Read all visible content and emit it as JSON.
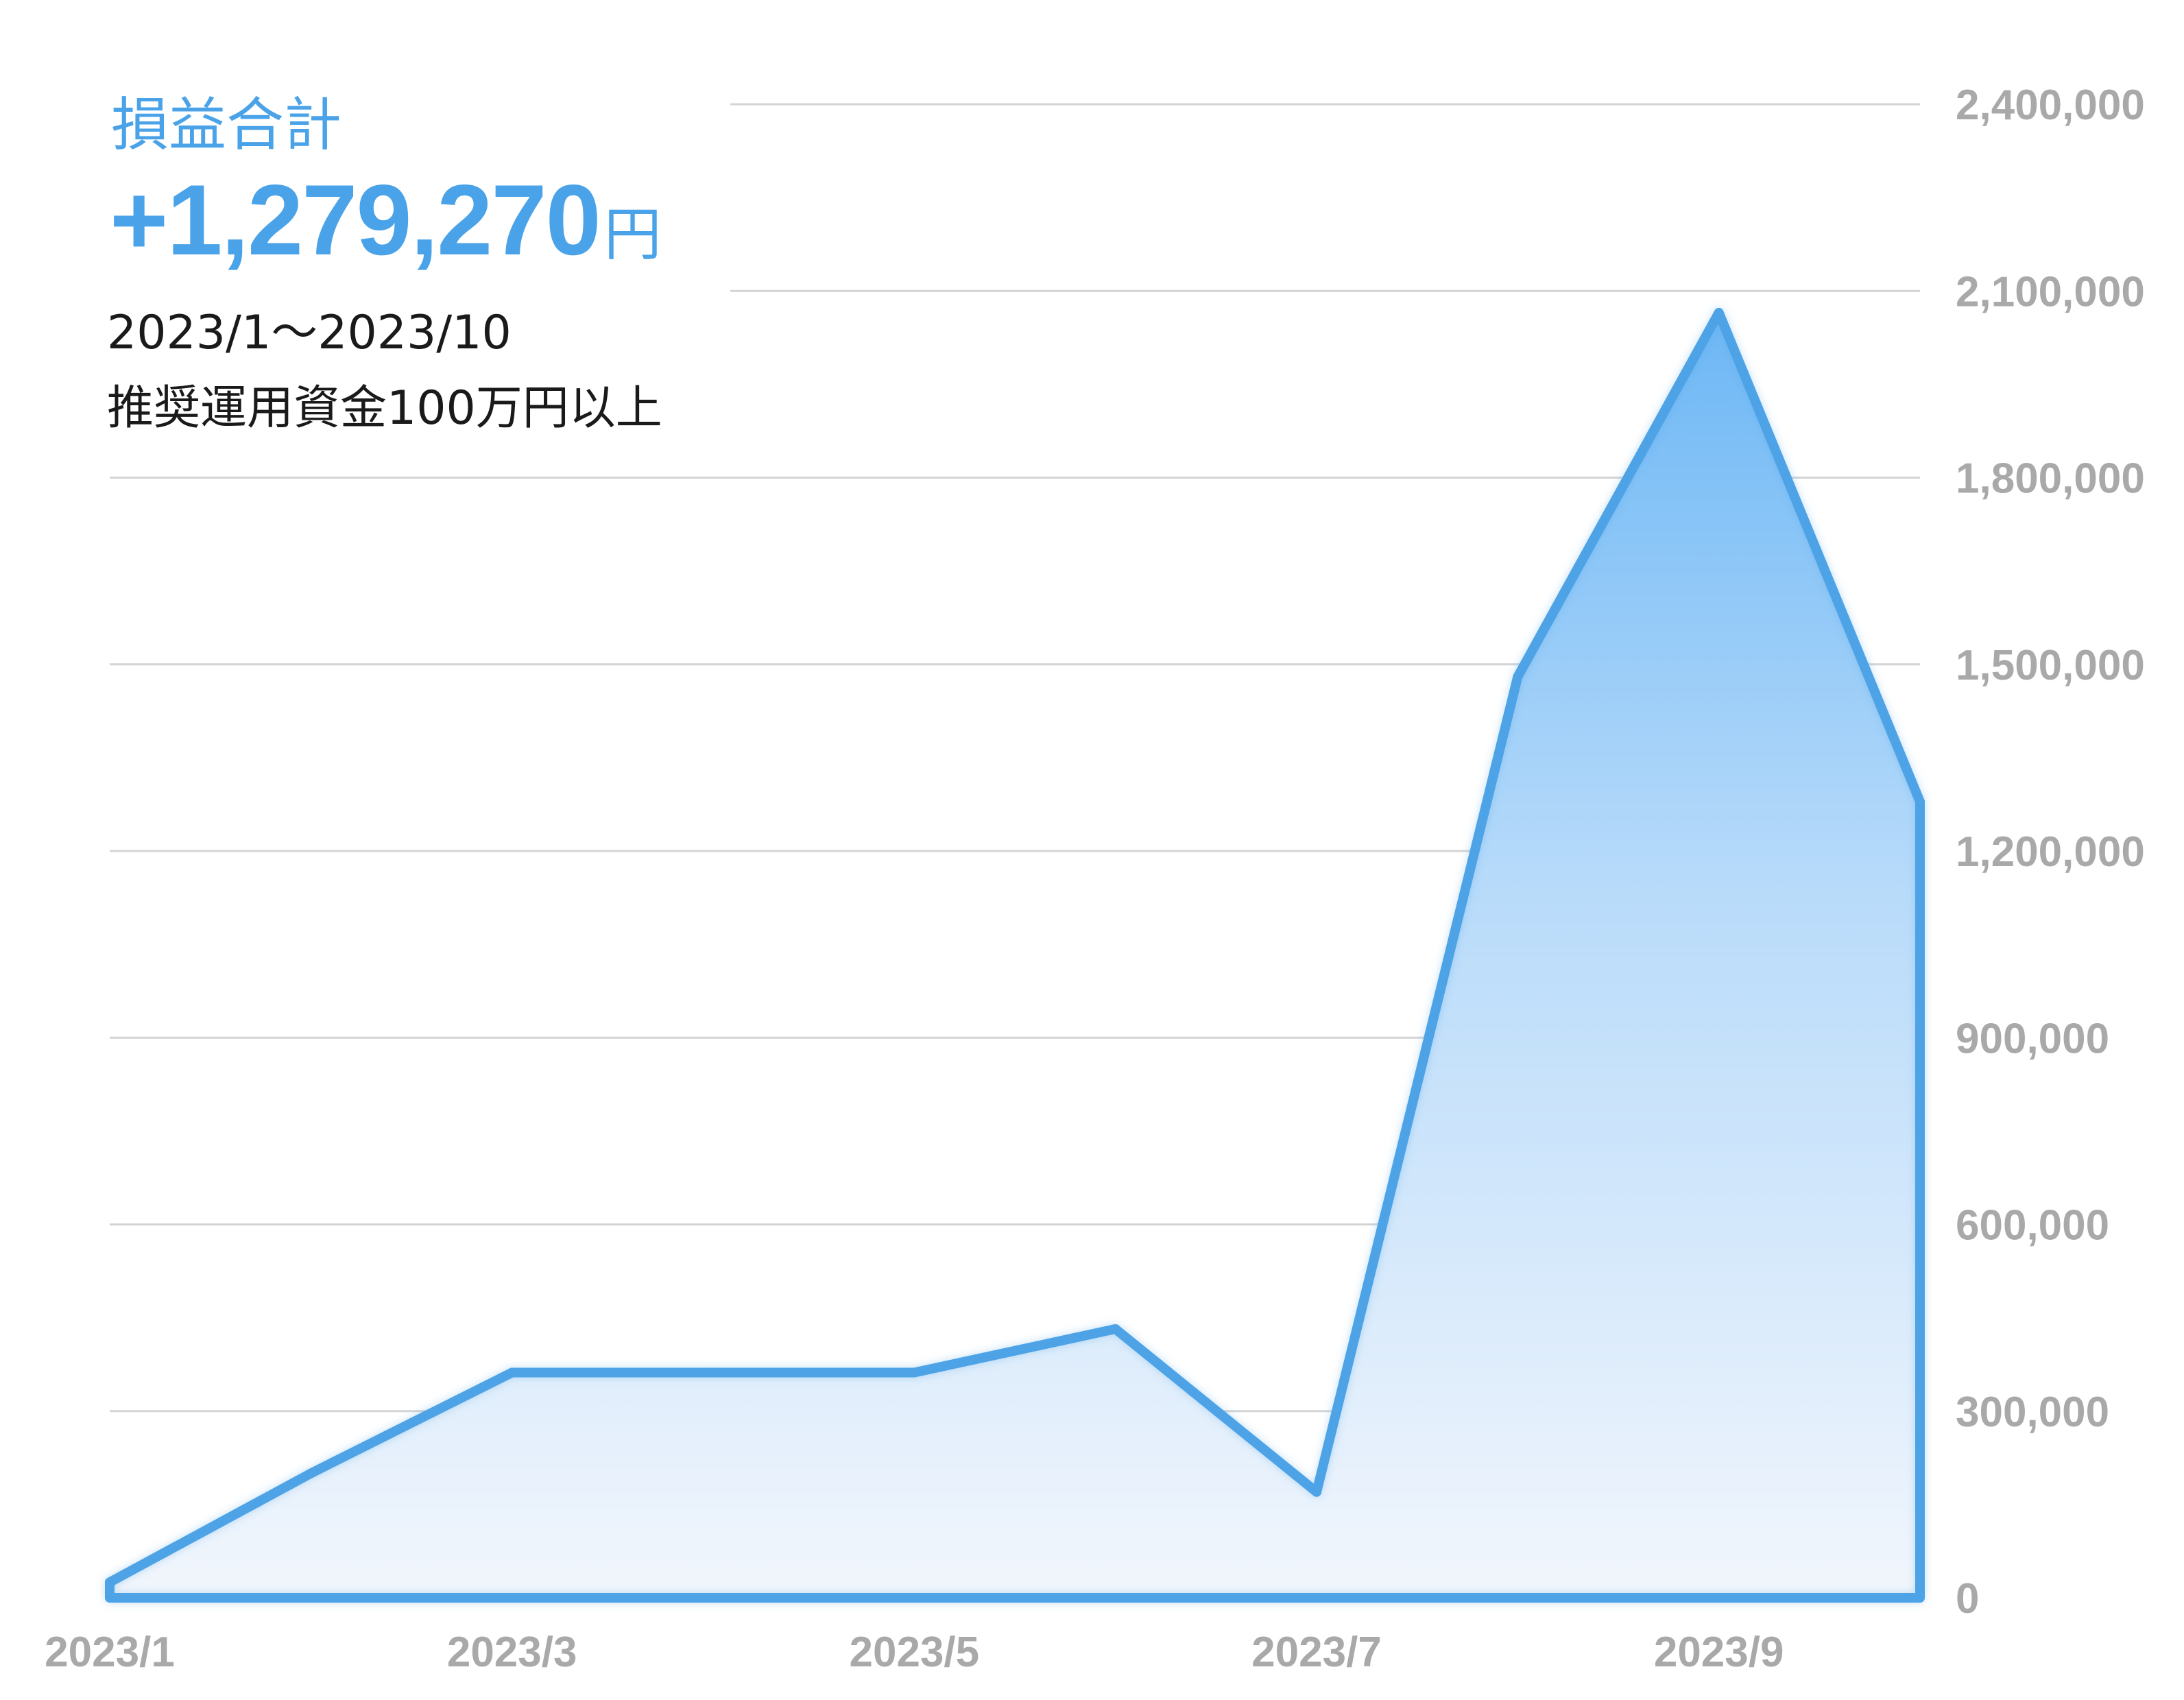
{
  "header": {
    "title": "損益合計",
    "total_value": "+1,279,270",
    "total_unit": "円",
    "period": "2023/1～2023/10",
    "note": "推奨運用資金100万円以上"
  },
  "colors": {
    "accent": "#4aa3e8",
    "line": "#4da3e6",
    "fill_top": "#6db7f5",
    "fill_bottom": "#f2f6fc",
    "grid": "#d4d4d4",
    "tick": "#a9a9a9"
  },
  "chart_data": {
    "type": "area",
    "x": [
      "2023/1",
      "2023/2",
      "2023/3",
      "2023/4",
      "2023/5",
      "2023/6",
      "2023/7",
      "2023/8",
      "2023/9",
      "2023/10"
    ],
    "xtick_labels": [
      "2023/1",
      "2023/3",
      "2023/5",
      "2023/7",
      "2023/9"
    ],
    "series": [
      {
        "values": [
          25000,
          200000,
          362000,
          362000,
          362000,
          432000,
          170000,
          1480000,
          2065000,
          1279270
        ]
      }
    ],
    "ylim": [
      0,
      2400000
    ],
    "yticks": [
      0,
      300000,
      600000,
      900000,
      1200000,
      1500000,
      1800000,
      2100000,
      2400000
    ],
    "ytick_labels": [
      "0",
      "300,000",
      "600,000",
      "900,000",
      "1,200,000",
      "1,500,000",
      "1,800,000",
      "2,100,000",
      "2,400,000"
    ],
    "yaxis_side": "right",
    "grid": true,
    "legend": false
  }
}
